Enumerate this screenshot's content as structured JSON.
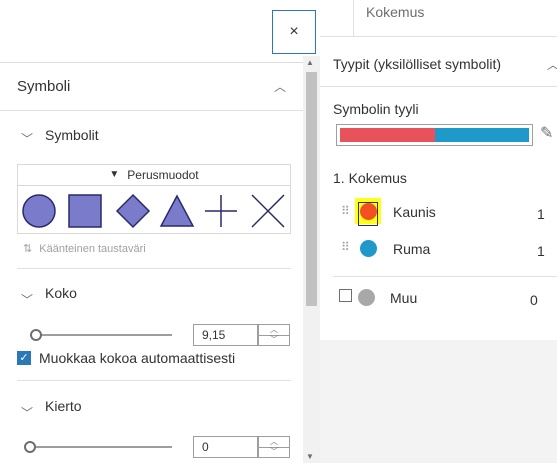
{
  "left_panel": {
    "close_label": "×",
    "symbol_section": "Symboli",
    "symbols_sub": "Symbolit",
    "shapes_dropdown": "Perusmuodot",
    "shapes": [
      "circle-shape",
      "square-shape",
      "diamond-shape",
      "triangle-shape",
      "plus-shape",
      "cross-shape"
    ],
    "inverse_bg_label": "Käänteinen taustaväri",
    "size_sub": "Koko",
    "size_value": "9,15",
    "auto_size_label": "Muokkaa kokoa automaattisesti",
    "rotation_sub": "Kierto",
    "rotation_value": "0",
    "shape_color": "#7b7bcc"
  },
  "right_panel": {
    "top_cutoff": "Kokemus",
    "section_title": "Tyypit (yksilölliset symbolit)",
    "style_label": "Symbolin tyyli",
    "field_label": "1. Kokemus",
    "categories": [
      {
        "label": "Kaunis",
        "count": "1",
        "color": "#f2501f"
      },
      {
        "label": "Ruma",
        "count": "1",
        "color": "#1e99c9"
      }
    ],
    "other": {
      "label": "Muu",
      "count": "0",
      "color": "#a8a8a8"
    },
    "ramp_colors": [
      "#e8525b",
      "#1e99c9"
    ]
  }
}
